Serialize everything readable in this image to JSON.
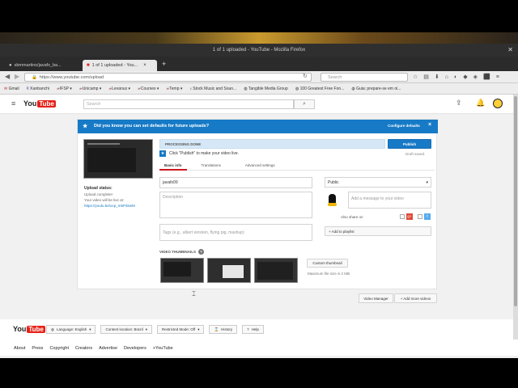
{
  "window": {
    "title": "1 of 1 uploaded - YouTube - Mozilla Firefox"
  },
  "tabs": [
    {
      "label": "sbmmartins/javafx_ba..."
    },
    {
      "label": "1 of 1 uploaded - You..."
    }
  ],
  "nav": {
    "url": "https://www.youtube.com/upload",
    "search_placeholder": "Search"
  },
  "bookmarks": [
    "Gmail",
    "Kanbanchi",
    "IFSP",
    "Unicamp",
    "Levanus",
    "Courses",
    "Temp",
    "Stock Music and Soun...",
    "Tangible Media Group",
    "100 Greatest Free Fon...",
    "Guia: prepare-se em oi..."
  ],
  "youtube": {
    "search_placeholder": "Search",
    "notice": {
      "text": "Did you know you can set defaults for future uploads?",
      "link": "Configure defaults",
      "close": "×"
    },
    "upload_status": {
      "title": "Upload status:",
      "line1": "Upload complete!",
      "line2": "Your video will be live at:",
      "link": "https://youtu.be/ocp_m5P4kwM"
    },
    "progress": {
      "label": "PROCESSING DONE",
      "percent": 100
    },
    "publish_label": "Publish",
    "draft_label": "Draft saved.",
    "hint": "Click \"Publish\" to make your video live.",
    "subtabs": [
      "Basic info",
      "Translations",
      "Advanced settings"
    ],
    "title_value": "javafx09",
    "description_placeholder": "Description",
    "tags_placeholder": "Tags (e.g., albert einstein, flying pig, mashup)",
    "privacy_value": "Public",
    "message_placeholder": "Add a message to your video",
    "also_share": "Also share on",
    "add_playlist": "+ Add to playlist",
    "thumbnails_label": "VIDEO THUMBNAILS",
    "custom_thumb": "Custom thumbnail",
    "max_size": "Maximum file size is 2 MB.",
    "video_manager": "Video Manager",
    "add_more": "+ Add more videos"
  },
  "footer": {
    "language": "Language: English",
    "location": "Content location: Brazil",
    "restricted": "Restricted Mode: Off",
    "history": "History",
    "help": "Help",
    "links": [
      "About",
      "Press",
      "Copyright",
      "Creators",
      "Advertise",
      "Developers",
      "+YouTube"
    ]
  },
  "colors": {
    "yt_red": "#e62117",
    "yt_blue": "#167ac6"
  }
}
